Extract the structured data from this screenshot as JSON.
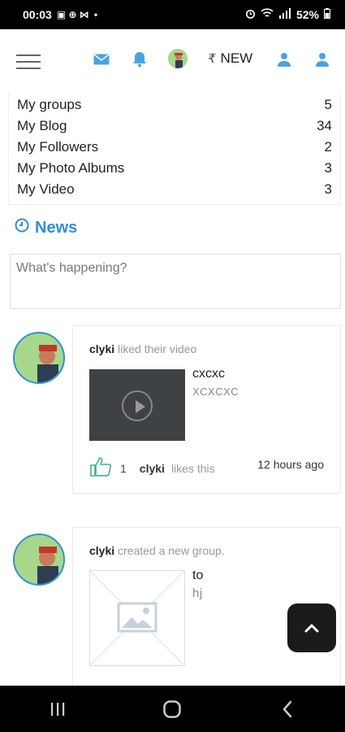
{
  "status_bar": {
    "time": "00:03",
    "left_glyphs": "▣ ⊕ ⋈",
    "dot": "•",
    "battery": "52%"
  },
  "header": {
    "icons": [
      "hamburger-menu-icon",
      "mail-icon",
      "bell-icon",
      "avatar-icon",
      "user-icon",
      "user-icon"
    ],
    "new_label": "NEW",
    "new_prefix": "₹"
  },
  "stats": [
    {
      "label": "My groups",
      "value": "5"
    },
    {
      "label": "My Blog",
      "value": "34"
    },
    {
      "label": "My Followers",
      "value": "2"
    },
    {
      "label": "My Photo Albums",
      "value": "3"
    },
    {
      "label": "My Video",
      "value": "3"
    }
  ],
  "news": {
    "title": "News",
    "composer_placeholder": "What's happening?"
  },
  "feed": [
    {
      "user": "clyki",
      "action": "liked their video",
      "media_title": "cxcxc",
      "media_sub": "XCXCXC",
      "likes_count": "1",
      "likes_user": "clyki",
      "likes_text": "likes this",
      "time": "12 hours ago"
    },
    {
      "user": "clyki",
      "action": "created a new group.",
      "media_title": "to",
      "media_sub": "hj"
    }
  ],
  "colors": {
    "accent": "#2f8fd9",
    "like": "#3cb38a"
  }
}
